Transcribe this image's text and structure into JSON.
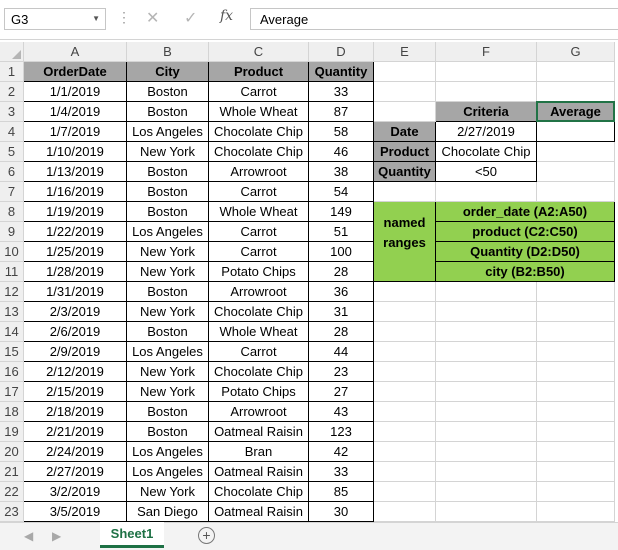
{
  "name_box": {
    "value": "G3"
  },
  "formula_bar": {
    "value": "Average",
    "fx_label": "fx",
    "cancel_glyph": "✕",
    "enter_glyph": "✓"
  },
  "columns": [
    "A",
    "B",
    "C",
    "D",
    "E",
    "F",
    "G"
  ],
  "rows": [
    "1",
    "2",
    "3",
    "4",
    "5",
    "6",
    "7",
    "8",
    "9",
    "10",
    "11",
    "12",
    "13",
    "14",
    "15",
    "16",
    "17",
    "18",
    "19",
    "20",
    "21",
    "22",
    "23"
  ],
  "table": {
    "headers": [
      "OrderDate",
      "City",
      "Product",
      "Quantity"
    ],
    "rows": [
      [
        "1/1/2019",
        "Boston",
        "Carrot",
        "33"
      ],
      [
        "1/4/2019",
        "Boston",
        "Whole Wheat",
        "87"
      ],
      [
        "1/7/2019",
        "Los Angeles",
        "Chocolate Chip",
        "58"
      ],
      [
        "1/10/2019",
        "New York",
        "Chocolate Chip",
        "46"
      ],
      [
        "1/13/2019",
        "Boston",
        "Arrowroot",
        "38"
      ],
      [
        "1/16/2019",
        "Boston",
        "Carrot",
        "54"
      ],
      [
        "1/19/2019",
        "Boston",
        "Whole Wheat",
        "149"
      ],
      [
        "1/22/2019",
        "Los Angeles",
        "Carrot",
        "51"
      ],
      [
        "1/25/2019",
        "New York",
        "Carrot",
        "100"
      ],
      [
        "1/28/2019",
        "New York",
        "Potato Chips",
        "28"
      ],
      [
        "1/31/2019",
        "Boston",
        "Arrowroot",
        "36"
      ],
      [
        "2/3/2019",
        "New York",
        "Chocolate Chip",
        "31"
      ],
      [
        "2/6/2019",
        "Boston",
        "Whole Wheat",
        "28"
      ],
      [
        "2/9/2019",
        "Los Angeles",
        "Carrot",
        "44"
      ],
      [
        "2/12/2019",
        "New York",
        "Chocolate Chip",
        "23"
      ],
      [
        "2/15/2019",
        "New York",
        "Potato Chips",
        "27"
      ],
      [
        "2/18/2019",
        "Boston",
        "Arrowroot",
        "43"
      ],
      [
        "2/21/2019",
        "Boston",
        "Oatmeal Raisin",
        "123"
      ],
      [
        "2/24/2019",
        "Los Angeles",
        "Bran",
        "42"
      ],
      [
        "2/27/2019",
        "Los Angeles",
        "Oatmeal Raisin",
        "33"
      ],
      [
        "3/2/2019",
        "New York",
        "Chocolate Chip",
        "85"
      ],
      [
        "3/5/2019",
        "San Diego",
        "Oatmeal Raisin",
        "30"
      ]
    ]
  },
  "criteria": {
    "header_criteria": "Criteria",
    "header_average": "Average",
    "average_value": "",
    "items": [
      {
        "label": "Date",
        "value": "2/27/2019"
      },
      {
        "label": "Product",
        "value": "Chocolate Chip"
      },
      {
        "label": "Quantity",
        "value": "<50"
      }
    ]
  },
  "named_ranges": {
    "label_line1": "named",
    "label_line2": "ranges",
    "items": [
      "order_date (A2:A50)",
      "product (C2:C50)",
      "Quantity (D2:D50)",
      "city (B2:B50)"
    ]
  },
  "sheet_tabs": {
    "active": "Sheet1",
    "add_glyph": "+",
    "prev_glyph": "◀",
    "next_glyph": "▶"
  },
  "colors": {
    "header_gray": "#a6a6a6",
    "named_green": "#92d050",
    "tab_green": "#1e7145"
  }
}
